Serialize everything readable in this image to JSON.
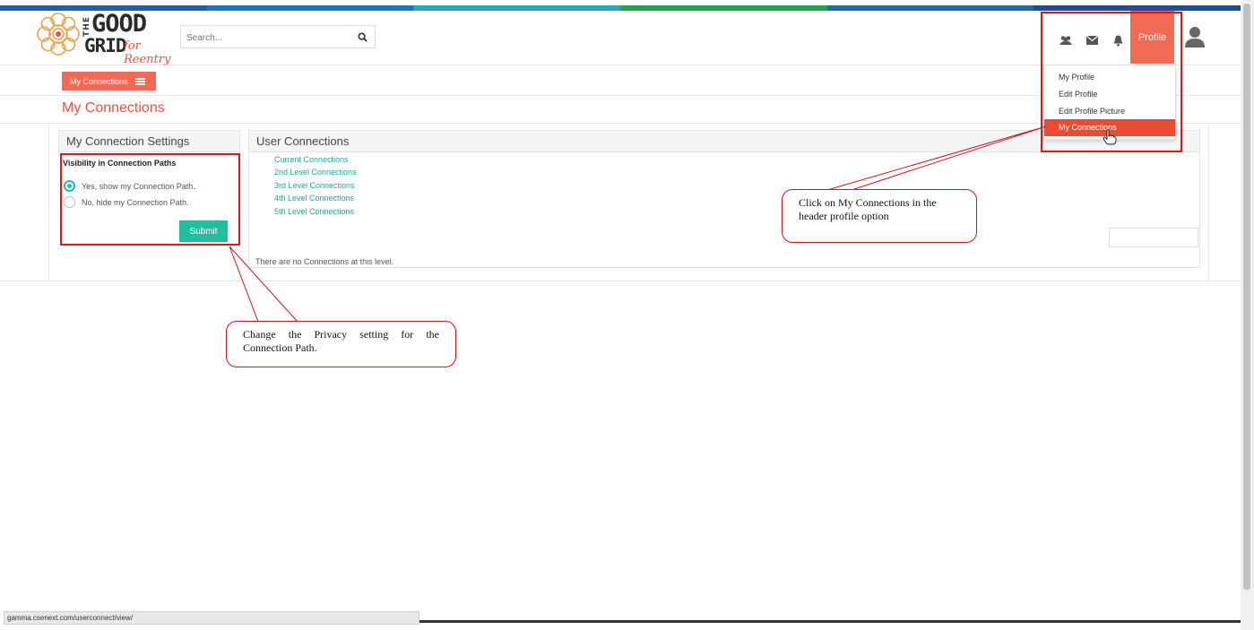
{
  "brand": {
    "line1": "GOOD",
    "line2": "GRID",
    "prefix": "THE",
    "tagline": "for Reentry",
    "stripe_colors": [
      "#1f5fa8",
      "#1f74c1",
      "#2aa3c2",
      "#23a24a",
      "#1e6aab",
      "#1b4e96"
    ]
  },
  "search": {
    "placeholder": "Search...",
    "icon": "search-icon"
  },
  "header": {
    "icons": [
      "users-icon",
      "envelope-icon",
      "bell-icon"
    ],
    "profile_label": "Profile",
    "avatar_icon": "user-avatar-icon"
  },
  "profile_menu": {
    "items": [
      {
        "label": "My Profile",
        "active": false
      },
      {
        "label": "Edit Profile",
        "active": false
      },
      {
        "label": "Edit Profile Picture",
        "active": false
      },
      {
        "label": "My Connections",
        "active": true
      }
    ]
  },
  "subnav": {
    "button_label": "My Connections"
  },
  "page": {
    "title": "My Connections"
  },
  "settings": {
    "heading": "My Connection Settings",
    "visibility_label": "Visibility in Connection Paths",
    "options": [
      {
        "label": "Yes, show my Connection Path.",
        "selected": true
      },
      {
        "label": "No, hide my Connection Path.",
        "selected": false
      }
    ],
    "submit_label": "Submit"
  },
  "user_connections": {
    "heading": "User Connections",
    "levels": [
      "Current Connections",
      "2nd Level Connections",
      "3rd Level Connections",
      "4th Level Connections",
      "5th Level Connections"
    ],
    "empty_message": "There are no Connections at this level."
  },
  "annotations": {
    "profile_callout": "Click on My Connections in the header profile option",
    "privacy_callout": "Change the Privacy setting for the Connection Path."
  },
  "status_bar": {
    "url": "gamma.csenext.com/userconnect/view/"
  },
  "colors": {
    "accent": "#f26a54",
    "teal": "#1fbfa0",
    "highlight": "#e3141b"
  }
}
